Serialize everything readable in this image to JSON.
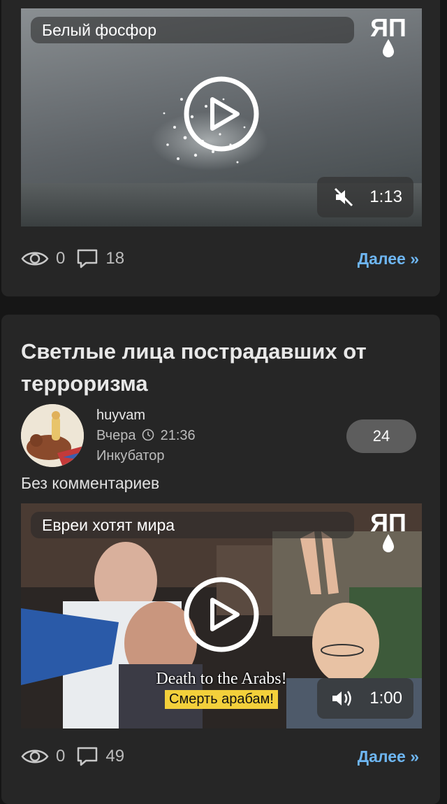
{
  "post1": {
    "video": {
      "title": "Белый фосфор",
      "duration": "1:13",
      "muted": true,
      "logo": "ЯП"
    },
    "stats": {
      "views": "0",
      "comments": "18",
      "more_label": "Далее »"
    }
  },
  "post2": {
    "title": "Светлые лица пострадавших от терроризма",
    "author": "huyvam",
    "date": "Вчера",
    "time": "21:36",
    "category": "Инкубатор",
    "rating": "24",
    "description": "Без комментариев",
    "video": {
      "title": "Евреи хотят мира",
      "duration": "1:00",
      "muted": false,
      "logo": "ЯП",
      "subtitle_en": "Death to the Arabs!",
      "subtitle_ru": "Смерть арабам!"
    },
    "stats": {
      "views": "0",
      "comments": "49",
      "more_label": "Далее »"
    }
  },
  "colors": {
    "link": "#6eb6f2",
    "card": "#262626",
    "background": "#161616",
    "subtitle_bg": "#f3d03b"
  }
}
